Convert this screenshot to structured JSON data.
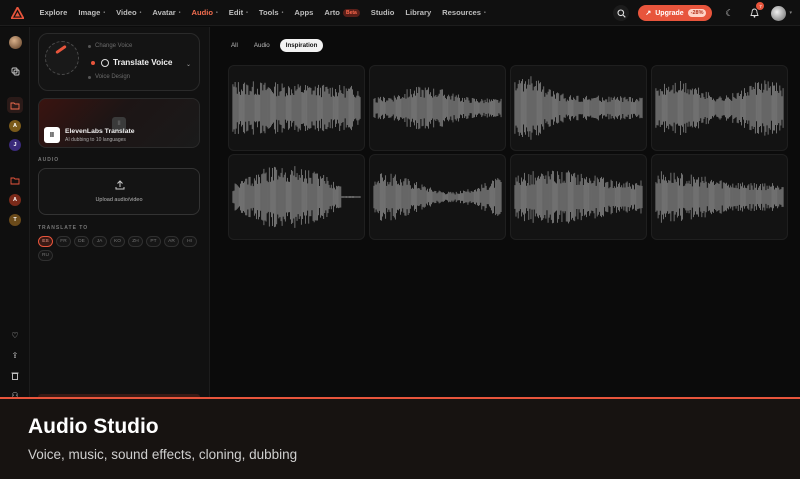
{
  "nav": {
    "items": [
      {
        "label": "Explore",
        "caret": false,
        "active": false
      },
      {
        "label": "Image",
        "caret": true,
        "active": false
      },
      {
        "label": "Video",
        "caret": true,
        "active": false
      },
      {
        "label": "Avatar",
        "caret": true,
        "active": false
      },
      {
        "label": "Audio",
        "caret": true,
        "active": true
      },
      {
        "label": "Edit",
        "caret": true,
        "active": false
      },
      {
        "label": "Tools",
        "caret": true,
        "active": false
      },
      {
        "label": "Apps",
        "caret": false,
        "active": false
      },
      {
        "label": "Arto",
        "caret": false,
        "active": false,
        "badge": "Beta"
      },
      {
        "label": "Studio",
        "caret": false,
        "active": false
      },
      {
        "label": "Library",
        "caret": false,
        "active": false
      },
      {
        "label": "Resources",
        "caret": true,
        "active": false
      }
    ],
    "upgrade_label": "Upgrade",
    "upgrade_discount": "-28%",
    "notification_count": "7"
  },
  "rail": {
    "dots": [
      "A",
      "J",
      "A",
      "T"
    ]
  },
  "mode": {
    "option_top": "Change Voice",
    "selected": "Translate Voice",
    "option_bottom": "Voice Design"
  },
  "promo": {
    "logo_text": "II",
    "title": "ElevenLabs Translate",
    "subtitle": "AI dubbing to 10 languages"
  },
  "audio": {
    "section_label": "AUDIO",
    "upload_label": "Upload audio/video"
  },
  "translate": {
    "section_label": "TRANSLATE TO",
    "languages": [
      "ES",
      "FR",
      "DE",
      "JA",
      "KO",
      "ZH",
      "PT",
      "AR",
      "HI",
      "RU"
    ],
    "selected": "ES"
  },
  "tabs": [
    {
      "label": "All",
      "active": false
    },
    {
      "label": "Audio",
      "active": false
    },
    {
      "label": "Inspiration",
      "active": true
    }
  ],
  "waveforms": [
    {
      "shape": "dense-left"
    },
    {
      "shape": "speech-mid"
    },
    {
      "shape": "peak-left"
    },
    {
      "shape": "music-dense"
    },
    {
      "shape": "swell-center"
    },
    {
      "shape": "even-tall"
    },
    {
      "shape": "dense-even"
    },
    {
      "shape": "tapered"
    }
  ],
  "caption": {
    "title": "Audio Studio",
    "subtitle": "Voice, music, sound effects, cloning, dubbing"
  },
  "colors": {
    "accent": "#e8553c",
    "background": "#0b0b0b"
  }
}
